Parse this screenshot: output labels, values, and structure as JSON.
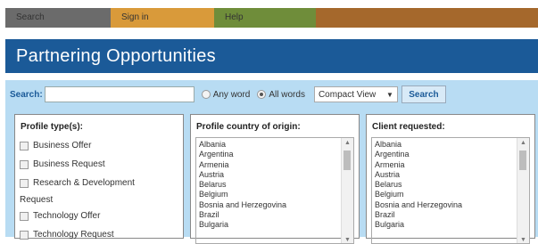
{
  "nav": {
    "search": "Search",
    "signin": "Sign in",
    "help": "Help"
  },
  "banner": {
    "title": "Partnering Opportunities"
  },
  "search": {
    "label": "Search:",
    "value": "",
    "radio_any": "Any word",
    "radio_all": "All words",
    "selected_radio": "All words",
    "view_select": "Compact View",
    "button": "Search"
  },
  "profile_type": {
    "title": "Profile type(s):",
    "options": [
      "Business Offer",
      "Business Request",
      "Research & Development"
    ],
    "continuation": "Request",
    "options2": [
      "Technology Offer",
      "Technology Request"
    ]
  },
  "country": {
    "title": "Profile country of origin:",
    "items": [
      "Albania",
      "Argentina",
      "Armenia",
      "Austria",
      "Belarus",
      "Belgium",
      "Bosnia and Herzegovina",
      "Brazil",
      "Bulgaria"
    ]
  },
  "client": {
    "title": "Client requested:",
    "items": [
      "Albania",
      "Argentina",
      "Armenia",
      "Austria",
      "Belarus",
      "Belgium",
      "Bosnia and Herzegovina",
      "Brazil",
      "Bulgaria"
    ]
  },
  "colors": {
    "banner": "#1b5a98",
    "panel": "#b8dcf3",
    "nav_search": "#6b6b6b",
    "nav_signin": "#d99a3a",
    "nav_help": "#6f8d3a",
    "nav_fill": "#a5682c"
  }
}
